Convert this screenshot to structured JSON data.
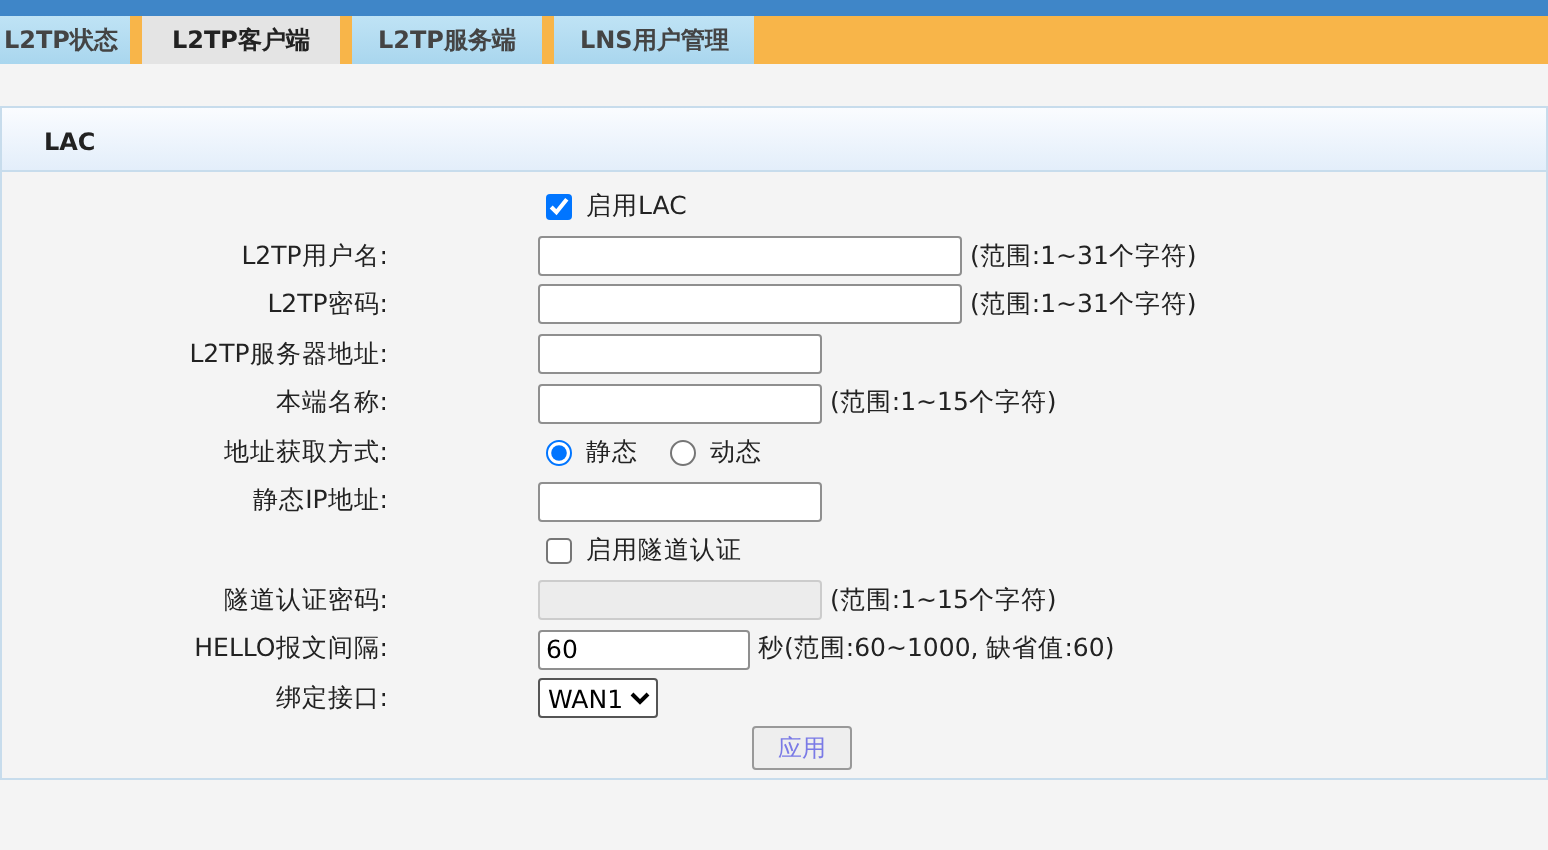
{
  "tabs": [
    {
      "label": "L2TP状态",
      "selected": false
    },
    {
      "label": "L2TP客户端",
      "selected": true
    },
    {
      "label": "L2TP服务端",
      "selected": false
    },
    {
      "label": "LNS用户管理",
      "selected": false
    }
  ],
  "panel": {
    "title": "LAC",
    "rows": [
      {
        "kind": "checkbox",
        "text": "启用LAC",
        "checked": true
      },
      {
        "kind": "account",
        "label": "L2TP用户名:",
        "hint": "(范围:1~31个字符)",
        "disabled": false
      },
      {
        "kind": "account",
        "label": "L2TP密码:",
        "hint": "(范围:1~31个字符)",
        "disabled": false
      },
      {
        "kind": "host",
        "label": "L2TP服务器地址:",
        "disabled": false
      },
      {
        "kind": "host",
        "label": "本端名称:",
        "hint": "(范围:1~15个字符)",
        "disabled": false
      },
      {
        "kind": "radio",
        "label": "地址获取方式:",
        "options": [
          {
            "label": "静态",
            "selected": true
          },
          {
            "label": "动态",
            "selected": false
          }
        ]
      },
      {
        "kind": "host",
        "label": "静态IP地址:",
        "disabled": false
      },
      {
        "kind": "checkbox",
        "text": "启用隧道认证",
        "checked": false
      },
      {
        "kind": "host",
        "label": "隧道认证密码:",
        "hint": "(范围:1~15个字符)",
        "disabled": true
      },
      {
        "kind": "number",
        "label": "HELLO报文间隔:",
        "value": "60",
        "hint": "秒(范围:60~1000, 缺省值:60)",
        "disabled": false
      },
      {
        "kind": "select",
        "label": "绑定接口:",
        "value": "WAN1"
      }
    ],
    "button": "应用"
  }
}
